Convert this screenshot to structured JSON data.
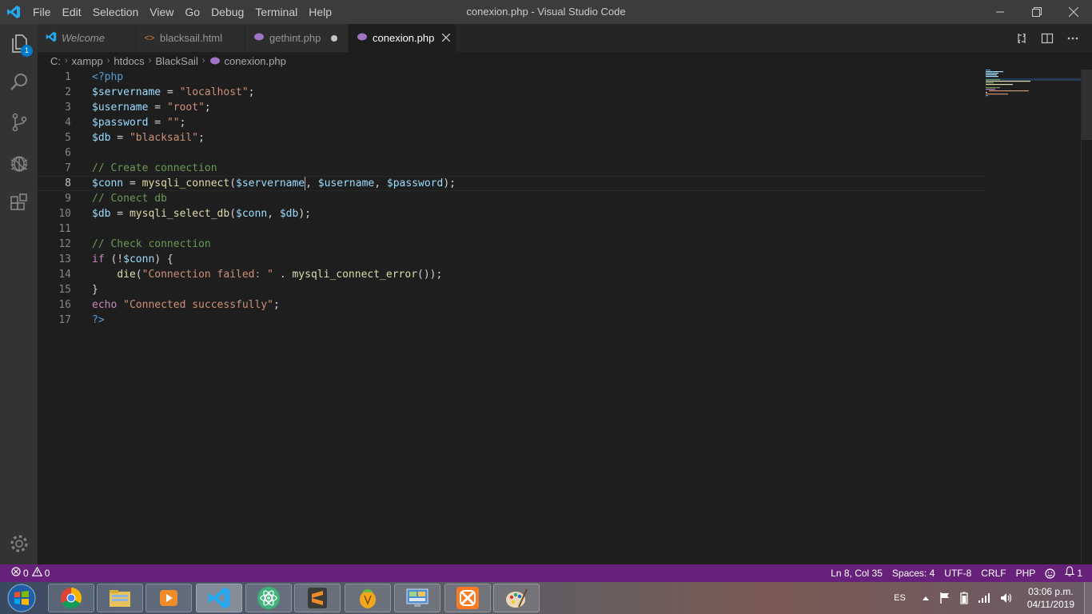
{
  "app": {
    "window_title": "conexion.php - Visual Studio Code",
    "menu": [
      "File",
      "Edit",
      "Selection",
      "View",
      "Go",
      "Debug",
      "Terminal",
      "Help"
    ],
    "accent": "#68217a"
  },
  "activity_bar": {
    "explorer_badge": "1",
    "items": [
      "files-icon",
      "search-icon",
      "source-control-icon",
      "debug-icon",
      "extensions-icon",
      "settings-gear-icon"
    ]
  },
  "tabs": [
    {
      "label": "Welcome",
      "icon": "vscode-logo-icon",
      "italic": true,
      "state": ""
    },
    {
      "label": "blacksail.html",
      "icon": "html-brackets-icon",
      "italic": false,
      "state": ""
    },
    {
      "label": "gethint.php",
      "icon": "php-elephant-icon",
      "italic": false,
      "state": "modified"
    },
    {
      "label": "conexion.php",
      "icon": "php-elephant-icon",
      "italic": false,
      "state": "active"
    }
  ],
  "breadcrumb": [
    "C:",
    "xampp",
    "htdocs",
    "BlackSail",
    "conexion.php"
  ],
  "editor": {
    "current_line": 8,
    "lines": [
      {
        "n": "1",
        "text": "<?php"
      },
      {
        "n": "2",
        "text": "$servername = \"localhost\";"
      },
      {
        "n": "3",
        "text": "$username = \"root\";"
      },
      {
        "n": "4",
        "text": "$password = \"\";"
      },
      {
        "n": "5",
        "text": "$db = \"blacksail\";"
      },
      {
        "n": "6",
        "text": ""
      },
      {
        "n": "7",
        "text": "// Create connection"
      },
      {
        "n": "8",
        "text": "$conn = mysqli_connect($servername, $username, $password);"
      },
      {
        "n": "9",
        "text": "// Conect db"
      },
      {
        "n": "10",
        "text": "$db = mysqli_select_db($conn, $db);"
      },
      {
        "n": "11",
        "text": ""
      },
      {
        "n": "12",
        "text": "// Check connection"
      },
      {
        "n": "13",
        "text": "if (!$conn) {"
      },
      {
        "n": "14",
        "text": "    die(\"Connection failed: \" . mysqli_connect_error());"
      },
      {
        "n": "15",
        "text": "}"
      },
      {
        "n": "16",
        "text": "echo \"Connected successfully\";"
      },
      {
        "n": "17",
        "text": "?>"
      }
    ]
  },
  "status_bar": {
    "errors": "0",
    "warnings": "0",
    "position": "Ln 8, Col 35",
    "indent": "Spaces: 4",
    "encoding": "UTF-8",
    "eol": "CRLF",
    "language": "PHP",
    "notifications": "1"
  },
  "taskbar": {
    "apps": [
      "windows-start-icon",
      "chrome-icon",
      "file-explorer-icon",
      "media-player-icon",
      "vscode-icon",
      "atom-icon",
      "sublime-text-icon",
      "fl-studio-icon",
      "control-panel-icon",
      "xampp-icon",
      "paint-icon"
    ],
    "language": "ES",
    "time": "03:06 p.m.",
    "date": "04/11/2019"
  }
}
